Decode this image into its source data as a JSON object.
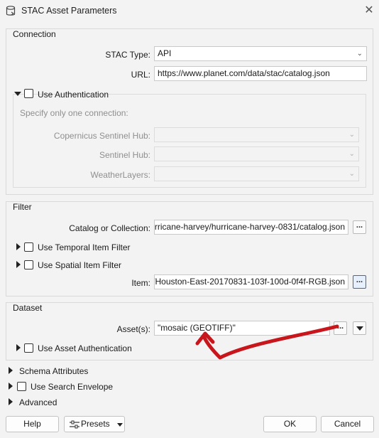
{
  "window": {
    "title": "STAC Asset Parameters"
  },
  "connection": {
    "group_label": "Connection",
    "stac_type_label": "STAC Type:",
    "stac_type_value": "API",
    "url_label": "URL:",
    "url_value": "https://www.planet.com/data/stac/catalog.json",
    "use_auth_label": "Use Authentication",
    "hint": "Specify only one connection:",
    "copernicus_label": "Copernicus Sentinel Hub:",
    "sentinel_label": "Sentinel Hub:",
    "weatherlayers_label": "WeatherLayers:"
  },
  "filter": {
    "group_label": "Filter",
    "catalog_label": "Catalog or Collection:",
    "catalog_value": "rricane-harvey/hurricane-harvey-0831/catalog.json",
    "temporal_label": "Use Temporal Item Filter",
    "spatial_label": "Use Spatial Item Filter",
    "item_label": "Item:",
    "item_value": "/Houston-East-20170831-103f-100d-0f4f-RGB.json",
    "dots": "..."
  },
  "dataset": {
    "group_label": "Dataset",
    "assets_label": "Asset(s):",
    "assets_value": "\"mosaic (GEOTIFF)\"",
    "asset_auth_label": "Use Asset Authentication"
  },
  "sections": {
    "schema_label": "Schema Attributes",
    "envelope_label": "Use Search Envelope",
    "advanced_label": "Advanced"
  },
  "footer": {
    "help_label": "Help",
    "presets_label": "Presets",
    "ok_label": "OK",
    "cancel_label": "Cancel"
  },
  "colors": {
    "annotation_arrow": "#c8161d",
    "accent": "#2a6bcc"
  }
}
